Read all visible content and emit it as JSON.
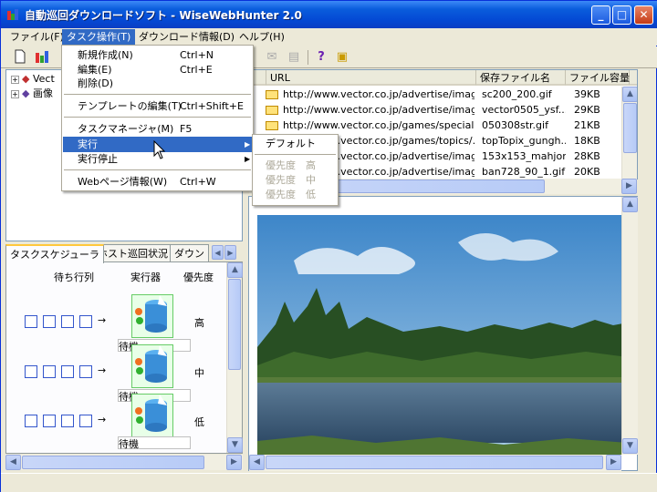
{
  "window": {
    "title": "自動巡回ダウンロードソフト - WiseWebHunter 2.0"
  },
  "menubar": {
    "items": [
      "ファイル(F)",
      "タスク操作(T)",
      "ダウンロード情報(D)",
      "ヘルプ(H)"
    ]
  },
  "task_menu": {
    "items": [
      {
        "label": "新規作成(N)",
        "shortcut": "Ctrl+N"
      },
      {
        "label": "編集(E)",
        "shortcut": "Ctrl+E"
      },
      {
        "label": "削除(D)",
        "shortcut": ""
      },
      {
        "label": "テンプレートの編集(T)",
        "shortcut": "Ctrl+Shift+E"
      },
      {
        "label": "タスクマネージャ(M)",
        "shortcut": "F5"
      },
      {
        "label": "実行",
        "shortcut": ""
      },
      {
        "label": "実行停止",
        "shortcut": ""
      },
      {
        "label": "Webページ情報(W)",
        "shortcut": "Ctrl+W"
      }
    ]
  },
  "run_submenu": {
    "items": [
      "デフォルト",
      "優先度　高",
      "優先度　中",
      "優先度　低"
    ]
  },
  "tree": {
    "items": [
      "Vect",
      "画像"
    ]
  },
  "list": {
    "headers": [
      "URL",
      "保存ファイル名",
      "ファイル容量"
    ],
    "rows": [
      {
        "url": "http://www.vector.co.jp/advertise/imag...",
        "file": "sc200_200.gif",
        "size": "39KB"
      },
      {
        "url": "http://www.vector.co.jp/advertise/imag...",
        "file": "vector0505_ysf...",
        "size": "29KB"
      },
      {
        "url": "http://www.vector.co.jp/games/special...",
        "file": "050308str.gif",
        "size": "21KB"
      },
      {
        "url": "http://www.vector.co.jp/games/topics/...",
        "file": "topTopix_gungh...",
        "size": "18KB"
      },
      {
        "url": "http://www.vector.co.jp/advertise/imag...",
        "file": "153x153_mahjon...",
        "size": "28KB"
      },
      {
        "url": "http://www.vector.co.jp/advertise/imag...",
        "file": "ban728_90_1.gif",
        "size": "20KB"
      }
    ]
  },
  "tabs": [
    "タスクスケジューラ",
    "ホスト巡回状況",
    "ダウン"
  ],
  "scheduler": {
    "headers": [
      "待ち行列",
      "実行器",
      "優先度"
    ],
    "rows": [
      {
        "priority": "高",
        "status": "待機"
      },
      {
        "priority": "中",
        "status": "待機"
      },
      {
        "priority": "低",
        "status": "待機"
      }
    ],
    "arrow": "→"
  },
  "colors": {
    "menu_highlight": "#316ac5",
    "titlebar": "#0a5ddc",
    "window_bg": "#ece9d8"
  }
}
